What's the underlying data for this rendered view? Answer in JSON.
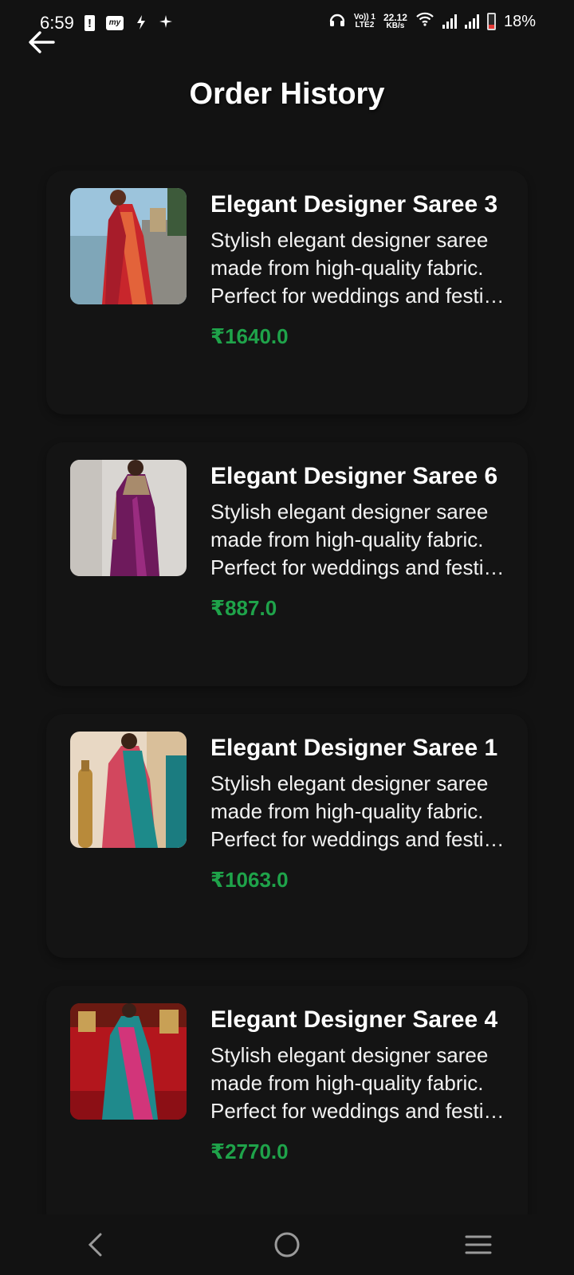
{
  "status_bar": {
    "time": "6:59",
    "net_top": "Vo)) 1",
    "net_bottom": "LTE2",
    "speed_value": "22.12",
    "speed_unit": "KB/s",
    "battery_percent": "18%",
    "myj_badge": "my"
  },
  "header": {
    "title": "Order History"
  },
  "orders": [
    {
      "name": "Elegant Designer Saree 3",
      "description": "Stylish elegant designer saree made from high-quality fabric. Perfect for weddings and festive occasions.",
      "price": "₹1640.0"
    },
    {
      "name": "Elegant Designer Saree 6",
      "description": "Stylish elegant designer saree made from high-quality fabric. Perfect for weddings and festive occasions.",
      "price": "₹887.0"
    },
    {
      "name": "Elegant Designer Saree 1",
      "description": "Stylish elegant designer saree made from high-quality fabric. Perfect for weddings and festive occasions.",
      "price": "₹1063.0"
    },
    {
      "name": "Elegant Designer Saree 4",
      "description": "Stylish elegant designer saree made from high-quality fabric. Perfect for weddings and festive occasions.",
      "price": "₹2770.0"
    }
  ],
  "colors": {
    "background": "#121212",
    "card": "#141414",
    "price": "#1fa34a",
    "text": "#ffffff"
  },
  "icons": {
    "back": "arrow-left-icon",
    "nav_back": "chevron-left-icon",
    "nav_home": "circle-home-icon",
    "nav_menu": "hamburger-menu-icon"
  }
}
